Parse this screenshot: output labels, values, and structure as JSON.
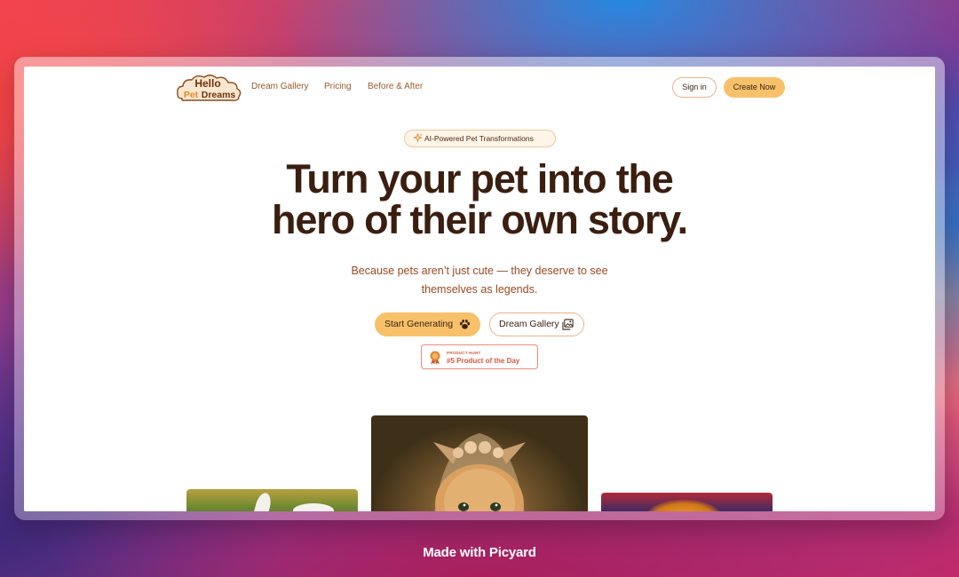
{
  "brand": {
    "logo_line1": "Hello",
    "logo_line2a": "Pet",
    "logo_line2b": "Dreams"
  },
  "nav": {
    "links": [
      "Dream Gallery",
      "Pricing",
      "Before & After"
    ],
    "signin_label": "Sign in",
    "create_label": "Create Now"
  },
  "hero": {
    "pill_label": "AI-Powered Pet Transformations",
    "title_line1": "Turn your pet into the",
    "title_line2": "hero of their own story.",
    "subtitle_line1": "Because pets aren’t just cute — they deserve to see",
    "subtitle_line2": "themselves as legends.",
    "start_label": "Start Generating",
    "gallery_label": "Dream Gallery",
    "badge_small": "PRODUCT HUNT",
    "badge_big": "#5 Product of the Day"
  },
  "footer": {
    "text": "Made with Picyard"
  },
  "colors": {
    "accent": "#f7c16a",
    "text_dark": "#3a1f10",
    "text_brown": "#9a4a20",
    "badge_red": "#d8583f"
  },
  "icons": [
    "sparkle-icon",
    "paw-icon",
    "gallery-icon",
    "medal-icon"
  ]
}
